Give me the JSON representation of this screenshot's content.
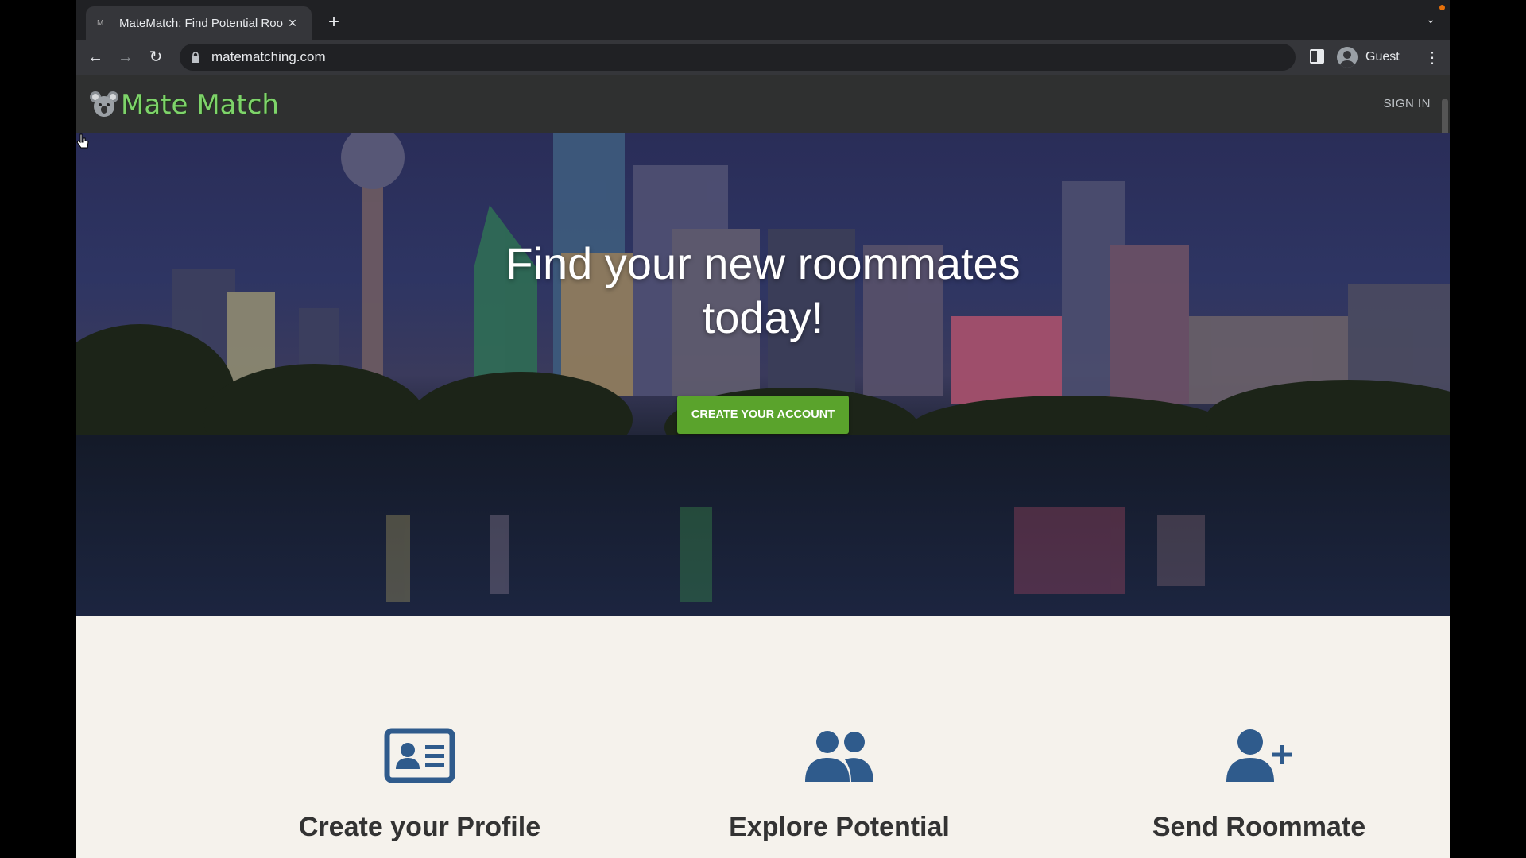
{
  "browser": {
    "tab_title": "MateMatch: Find Potential Roo",
    "tab_favicon": "M",
    "url": "matematching.com",
    "profile_label": "Guest"
  },
  "site": {
    "logo_text": "Mate Match",
    "signin_label": "SIGN IN",
    "hero_title": "Find your new roommates today!",
    "cta_label": "CREATE YOUR ACCOUNT",
    "features": [
      {
        "title": "Create your Profile",
        "icon": "profile-card-icon"
      },
      {
        "title": "Explore Potential",
        "icon": "users-icon"
      },
      {
        "title": "Send Roommate",
        "icon": "user-plus-icon"
      }
    ]
  },
  "colors": {
    "cta": "#5aa32c",
    "logo": "#7ed46a",
    "feature_icon": "#2f5b8c",
    "nav_bg": "#2f3030"
  }
}
